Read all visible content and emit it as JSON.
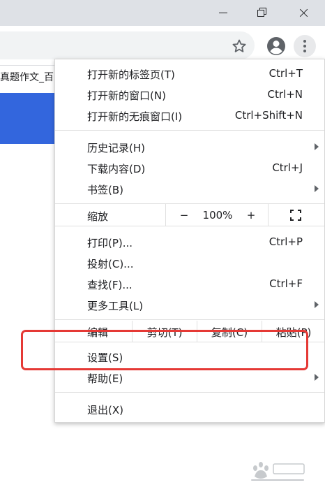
{
  "page": {
    "tab_text": "真题作文_百"
  },
  "menu": {
    "items": [
      {
        "label": "打开新的标签页(T)",
        "shortcut": "Ctrl+T"
      },
      {
        "label": "打开新的窗口(N)",
        "shortcut": "Ctrl+N"
      },
      {
        "label": "打开新的无痕窗口(I)",
        "shortcut": "Ctrl+Shift+N"
      },
      {
        "label": "历史记录(H)",
        "shortcut": ""
      },
      {
        "label": "下载内容(D)",
        "shortcut": "Ctrl+J"
      },
      {
        "label": "书签(B)",
        "shortcut": ""
      },
      {
        "label": "打印(P)...",
        "shortcut": "Ctrl+P"
      },
      {
        "label": "投射(C)...",
        "shortcut": ""
      },
      {
        "label": "查找(F)...",
        "shortcut": "Ctrl+F"
      },
      {
        "label": "更多工具(L)",
        "shortcut": ""
      },
      {
        "label": "设置(S)",
        "shortcut": ""
      },
      {
        "label": "帮助(E)",
        "shortcut": ""
      },
      {
        "label": "退出(X)",
        "shortcut": ""
      }
    ],
    "zoom": {
      "label": "缩放",
      "minus": "−",
      "value": "100%",
      "plus": "+"
    },
    "edit": {
      "label": "编辑",
      "cut": "剪切(T)",
      "copy": "复制(C)",
      "paste": "粘贴(P)"
    }
  },
  "colors": {
    "highlight": "#e53935",
    "banner": "#3366dd"
  },
  "icons": [
    "minimize-icon",
    "maximize-icon",
    "close-icon",
    "star-icon",
    "profile-icon",
    "kebab-menu-icon",
    "fullscreen-icon",
    "submenu-arrow-icon"
  ],
  "watermark": {
    "text": "Baidu经验",
    "sub": "jingyan.baidu.com"
  }
}
